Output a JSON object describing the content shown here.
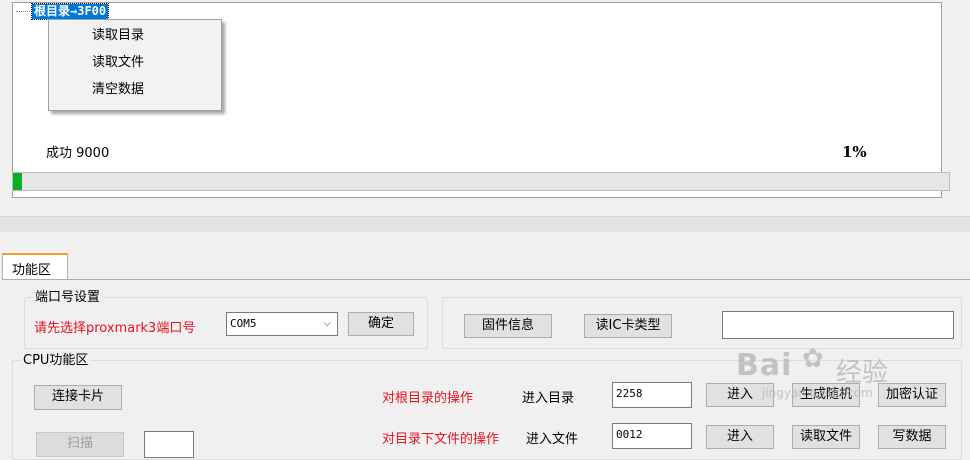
{
  "tree": {
    "node_label": "根目录→3F00"
  },
  "context_menu": {
    "items": [
      "读取目录",
      "读取文件",
      "清空数据"
    ]
  },
  "status": {
    "message": "成功 9000",
    "percent_text": "1%",
    "progress_percent": 1,
    "progress_color": "#06b025"
  },
  "tab": {
    "label": "功能区"
  },
  "port_group": {
    "title": "端口号设置",
    "hint": "请先选择proxmark3端口号",
    "selected_port": "COM5",
    "confirm_label": "确定"
  },
  "info_group": {
    "firmware_label": "固件信息",
    "card_type_label": "读IC卡类型",
    "output_value": ""
  },
  "cpu_group": {
    "title": "CPU功能区",
    "connect_label": "连接卡片",
    "scan_label": "扫描",
    "scan_value": "",
    "root_ops_label": "对根目录的操作",
    "enter_dir_label": "进入目录",
    "dir_value": "2258",
    "enter_label": "进入",
    "random_label": "生成随机",
    "auth_label": "加密认证",
    "file_ops_label": "对目录下文件的操作",
    "enter_file_label": "进入文件",
    "file_value": "0012",
    "enter2_label": "进入",
    "read_file_label": "读取文件",
    "write_label": "写数据"
  },
  "watermark": {
    "brand": "Bai",
    "brand2": "经验",
    "url": "jingyan.baidu.com"
  }
}
